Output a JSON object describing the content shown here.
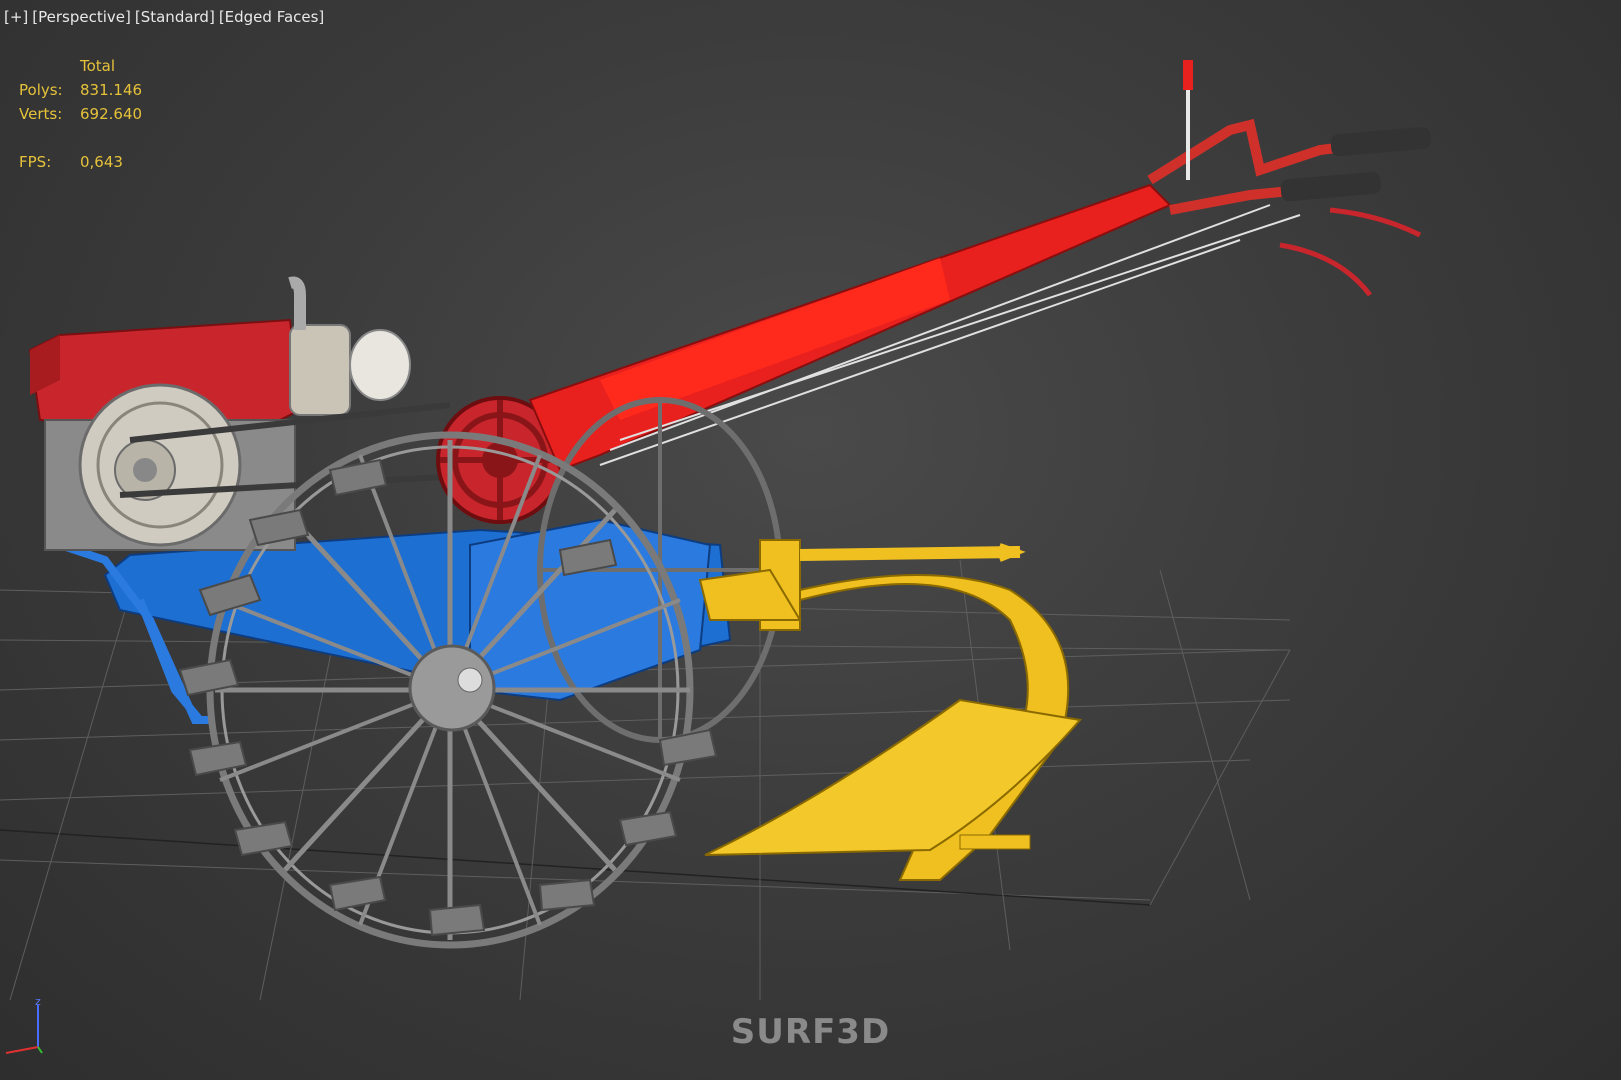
{
  "viewport": {
    "menu_plus": "[+]",
    "view_mode": "[Perspective]",
    "shading_preset": "[Standard]",
    "display_mode": "[Edged Faces]"
  },
  "stats": {
    "header": "Total",
    "polys_label": "Polys:",
    "polys_value": "831.146",
    "verts_label": "Verts:",
    "verts_value": "692.640",
    "fps_label": "FPS:",
    "fps_value": "0,643"
  },
  "watermark": "SURF3D",
  "gizmo": {
    "z_label": "z"
  },
  "colors": {
    "background": "#3c3c3c",
    "grid": "#5a5a5a",
    "engine_red": "#c8262c",
    "handle_red": "#e8201e",
    "frame_blue": "#1e6fd2",
    "plough_yellow": "#f0c020",
    "wheel_gray": "#8a8a8a",
    "stats_yellow": "#e6c23a"
  },
  "scene": {
    "model": "walk-behind tractor with plough",
    "parts": [
      "engine",
      "flywheel",
      "belt-pulley",
      "handlebar",
      "cage-wheel",
      "frame",
      "plough"
    ]
  }
}
